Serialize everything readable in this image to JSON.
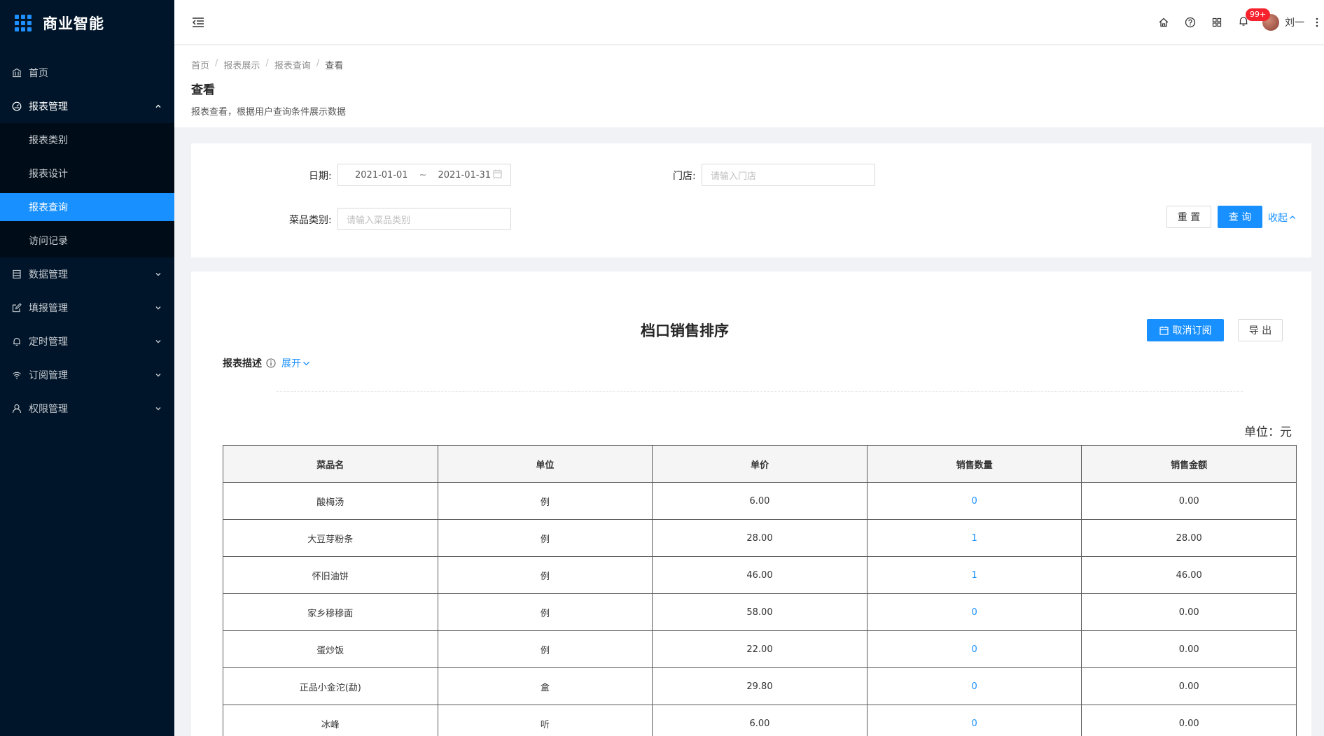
{
  "app": {
    "title": "商业智能"
  },
  "sidebar": {
    "items": [
      {
        "label": "首页",
        "icon": "bank-icon"
      },
      {
        "label": "报表管理",
        "icon": "dashboard-icon",
        "open": true,
        "children": [
          {
            "label": "报表类别"
          },
          {
            "label": "报表设计"
          },
          {
            "label": "报表查询",
            "active": true
          },
          {
            "label": "访问记录"
          }
        ]
      },
      {
        "label": "数据管理",
        "icon": "database-icon"
      },
      {
        "label": "填报管理",
        "icon": "form-icon"
      },
      {
        "label": "定时管理",
        "icon": "bell-icon"
      },
      {
        "label": "订阅管理",
        "icon": "wifi-icon"
      },
      {
        "label": "权限管理",
        "icon": "user-icon"
      }
    ]
  },
  "header": {
    "notification_badge": "99+",
    "username": "刘一"
  },
  "breadcrumb": [
    "首页",
    "报表展示",
    "报表查询",
    "查看"
  ],
  "page": {
    "title": "查看",
    "description": "报表查看，根据用户查询条件展示数据"
  },
  "filters": {
    "date_label": "日期:",
    "date_start": "2021-01-01",
    "date_sep": "~",
    "date_end": "2021-01-31",
    "store_label": "门店:",
    "store_placeholder": "请输入门店",
    "category_label": "菜品类别:",
    "category_placeholder": "请输入菜品类别",
    "reset_label": "重 置",
    "query_label": "查 询",
    "collapse_label": "收起"
  },
  "report": {
    "title": "档口销售排序",
    "unsubscribe_label": "取消订阅",
    "export_label": "导 出",
    "description_label": "报表描述",
    "expand_label": "展开",
    "unit_text": "单位：元",
    "columns": [
      "菜品名",
      "单位",
      "单价",
      "销售数量",
      "销售金额"
    ],
    "rows": [
      [
        "酸梅汤",
        "例",
        "6.00",
        "0",
        "0.00"
      ],
      [
        "大豆芽粉条",
        "例",
        "28.00",
        "1",
        "28.00"
      ],
      [
        "怀旧油饼",
        "例",
        "46.00",
        "1",
        "46.00"
      ],
      [
        "家乡穇穇面",
        "例",
        "58.00",
        "0",
        "0.00"
      ],
      [
        "蛋炒饭",
        "例",
        "22.00",
        "0",
        "0.00"
      ],
      [
        "正品小金沱(勐)",
        "盒",
        "29.80",
        "0",
        "0.00"
      ],
      [
        "冰峰",
        "听",
        "6.00",
        "0",
        "0.00"
      ]
    ]
  },
  "colors": {
    "primary": "#1890ff",
    "sidebar_bg": "#001529",
    "badge": "#f5222d"
  }
}
